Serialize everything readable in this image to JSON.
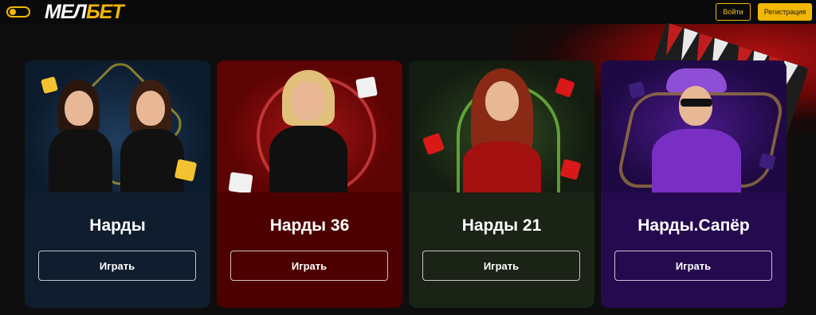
{
  "header": {
    "logo_part1": "МЕЛ",
    "logo_part2": "БЕТ",
    "login_label": "Войти",
    "register_label": "Регистрация",
    "accent_color": "#f2b705"
  },
  "games": [
    {
      "title": "Нарды",
      "play_label": "Играть",
      "bg": "#0f1d2e"
    },
    {
      "title": "Нарды 36",
      "play_label": "Играть",
      "bg": "#4d0000"
    },
    {
      "title": "Нарды 21",
      "play_label": "Играть",
      "bg": "#1b2216"
    },
    {
      "title": "Нарды.Сапёр",
      "play_label": "Играть",
      "bg": "#260a4f"
    }
  ]
}
